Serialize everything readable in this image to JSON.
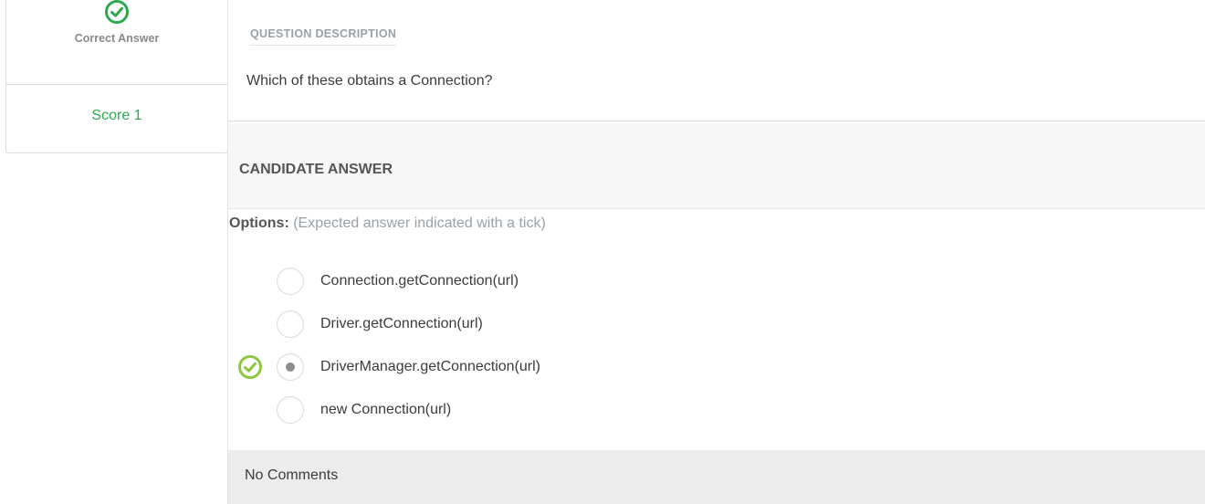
{
  "status": {
    "icon": "check-circle-icon",
    "label": "Correct Answer",
    "score": "Score 1",
    "color": "#2daa4f"
  },
  "question": {
    "section_label": "QUESTION DESCRIPTION",
    "text": "Which of these obtains a Connection?"
  },
  "candidate": {
    "title": "CANDIDATE ANSWER",
    "options_label": "Options:",
    "options_hint": "(Expected answer indicated with a tick)",
    "options": [
      {
        "label": "Connection.getConnection(url)",
        "selected": false,
        "expected": false
      },
      {
        "label": "Driver.getConnection(url)",
        "selected": false,
        "expected": false
      },
      {
        "label": "DriverManager.getConnection(url)",
        "selected": true,
        "expected": true
      },
      {
        "label": "new Connection(url)",
        "selected": false,
        "expected": false
      }
    ],
    "tick_color": "#8dc63f"
  },
  "comments": {
    "text": "No Comments"
  }
}
